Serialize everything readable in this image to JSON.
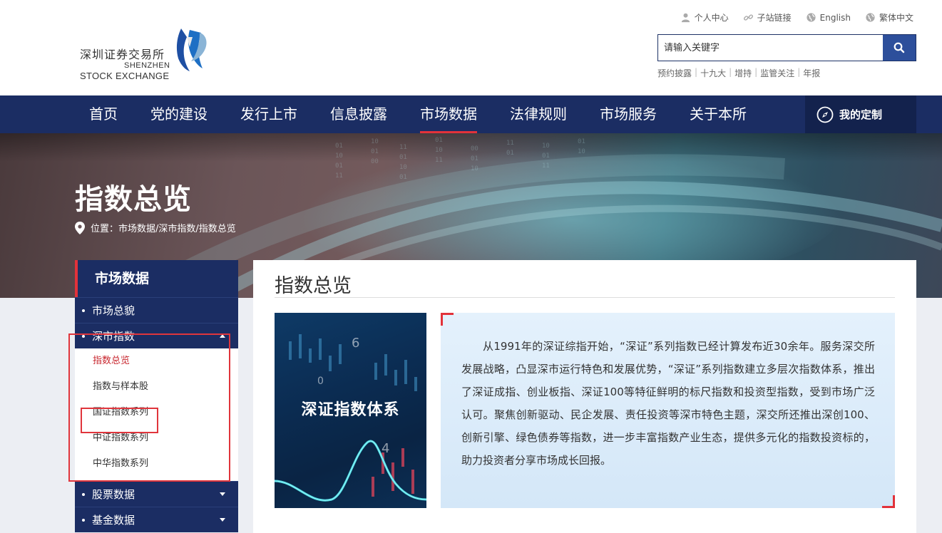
{
  "header": {
    "logo": {
      "cn": "深圳证券交易所",
      "en_line1": "SHENZHEN",
      "en_line2": "STOCK EXCHANGE"
    },
    "top_links": [
      {
        "label": "个人中心",
        "icon": "user-icon"
      },
      {
        "label": "子站链接",
        "icon": "link-icon"
      },
      {
        "label": "English",
        "icon": "globe-icon"
      },
      {
        "label": "繁体中文",
        "icon": "globe-icon"
      }
    ],
    "search": {
      "placeholder": "请输入关键字"
    },
    "quick_links": [
      "预约披露",
      "十九大",
      "增持",
      "监管关注",
      "年报"
    ]
  },
  "nav": {
    "items": [
      "首页",
      "党的建设",
      "发行上市",
      "信息披露",
      "市场数据",
      "法律规则",
      "市场服务",
      "关于本所"
    ],
    "active": "市场数据",
    "custom": "我的定制"
  },
  "banner": {
    "title": "指数总览",
    "breadcrumb": "位置：市场数据/深市指数/指数总览"
  },
  "sidebar": {
    "title": "市场数据",
    "groups": [
      {
        "label": "市场总貌"
      },
      {
        "label": "深市指数",
        "expanded": true,
        "items": [
          "指数总览",
          "指数与样本股",
          "国证指数系列",
          "中证指数系列",
          "中华指数系列"
        ],
        "active": "指数总览"
      },
      {
        "label": "股票数据"
      },
      {
        "label": "基金数据"
      }
    ]
  },
  "main": {
    "title": "指数总览",
    "image_text": "深证指数体系",
    "intro": "从1991年的深证综指开始，“深证”系列指数已经计算发布近30余年。服务深交所发展战略，凸显深市运行特色和发展优势，“深证”系列指数建立多层次指数体系，推出了深证成指、创业板指、深证100等特征鲜明的标尺指数和投资型指数，受到市场广泛认可。聚焦创新驱动、民企发展、责任投资等深市特色主题，深交所还推出深创100、创新引擎、绿色债券等指数，进一步丰富指数产业生态，提供多元化的指数投资标的，助力投资者分享市场成长回报。"
  },
  "colors": {
    "navy": "#1b2d63",
    "accent_red": "#e2323a",
    "search_button": "#2d4f9b"
  }
}
